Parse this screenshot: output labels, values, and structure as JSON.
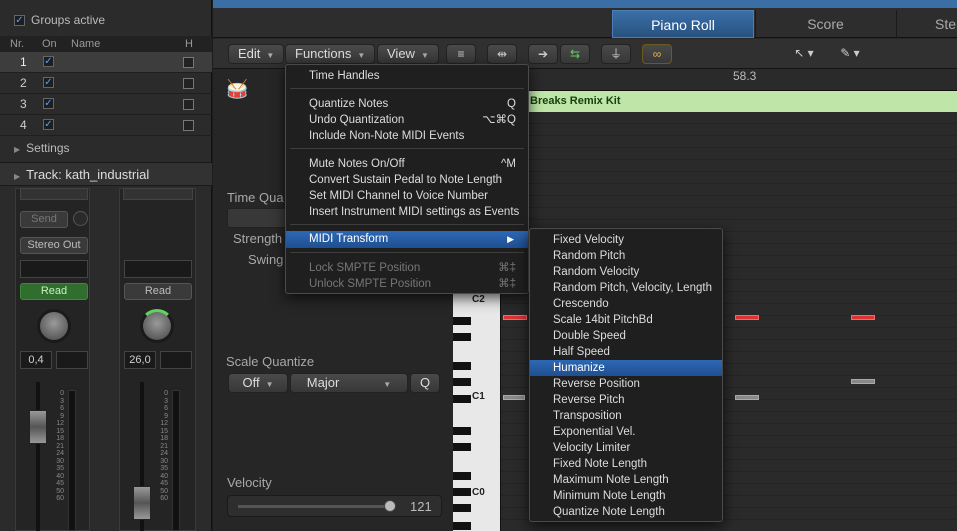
{
  "inspector": {
    "groups_active": "Groups active",
    "headers": {
      "nr": "Nr.",
      "on": "On",
      "name": "Name",
      "h": "H"
    },
    "rows": [
      {
        "nr": "1"
      },
      {
        "nr": "2"
      },
      {
        "nr": "3"
      },
      {
        "nr": "4"
      }
    ],
    "settings": "Settings",
    "track_label": "Track:",
    "track_name": "kath_industrial",
    "send": "Send",
    "stereo_out": "Stereo Out",
    "read": "Read",
    "read2": "Read",
    "value1": "0,4",
    "value2": "26,0",
    "fader_scale": [
      "0",
      "3",
      "6",
      "9",
      "12",
      "15",
      "18",
      "21",
      "24",
      "30",
      "35",
      "40",
      "45",
      "50",
      "60"
    ]
  },
  "tabs": {
    "piano_roll": "Piano Roll",
    "score": "Score",
    "step": "Step"
  },
  "toolbar": {
    "edit": "Edit",
    "functions": "Functions",
    "view": "View"
  },
  "local": {
    "time_quantize": "Time Qua",
    "strength": "Strength",
    "swing": "Swing",
    "scale_quantize": "Scale Quantize",
    "scale_off": "Off",
    "scale_major": "Major",
    "scale_q": "Q",
    "velocity": "Velocity",
    "velocity_value": "121"
  },
  "editor": {
    "ruler_position": "58.3",
    "region_name": "Breaks Remix Kit",
    "keys": {
      "c2": "C2",
      "c1": "C1",
      "c0": "C0"
    }
  },
  "functions_menu": {
    "time_handles": "Time Handles",
    "quantize_notes": "Quantize Notes",
    "quantize_notes_sc": "Q",
    "undo_quantization": "Undo Quantization",
    "undo_quantization_sc": "⌥⌘Q",
    "include_non_note": "Include Non-Note MIDI Events",
    "mute_notes": "Mute Notes On/Off",
    "mute_notes_sc": "^M",
    "convert_sustain": "Convert Sustain Pedal to Note Length",
    "set_midi_channel": "Set MIDI Channel to Voice Number",
    "insert_instrument": "Insert Instrument MIDI settings as Events",
    "midi_transform": "MIDI Transform",
    "lock_smpte": "Lock SMPTE Position",
    "lock_smpte_sc": "⌘‡",
    "unlock_smpte": "Unlock SMPTE Position",
    "unlock_smpte_sc": "⌘‡"
  },
  "transform_menu": {
    "items": [
      "Fixed Velocity",
      "Random Pitch",
      "Random Velocity",
      "Random Pitch, Velocity, Length",
      "Crescendo",
      "Scale 14bit PitchBd",
      "Double Speed",
      "Half Speed",
      "Humanize",
      "Reverse Position",
      "Reverse Pitch",
      "Transposition",
      "Exponential Vel.",
      "Velocity Limiter",
      "Fixed Note Length",
      "Maximum Note Length",
      "Minimum Note Length",
      "Quantize Note Length"
    ],
    "highlighted": "Humanize"
  },
  "colors": {
    "accent": "#2d68b4",
    "region": "#bfe6a8",
    "read_green": "#2f6e2c",
    "note_red": "#dd3333"
  }
}
